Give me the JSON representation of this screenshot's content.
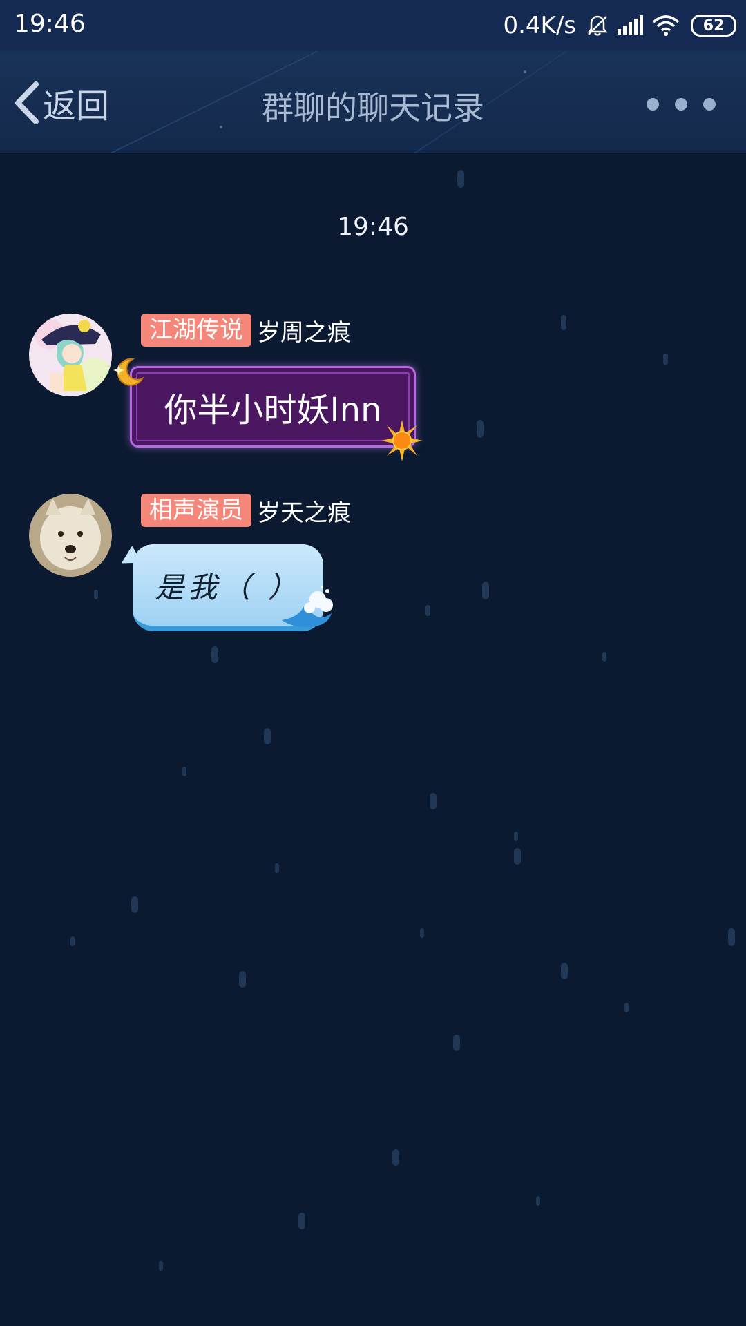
{
  "status_bar": {
    "time": "19:46",
    "net_speed": "0.4K/s",
    "battery": "62",
    "icons": [
      "bell-muted-icon",
      "signal-icon",
      "wifi-icon",
      "battery-icon"
    ]
  },
  "header": {
    "back_label": "返回",
    "title": "群聊的聊天记录",
    "more_icon": "more-icon"
  },
  "chat": {
    "timestamp": "19:46",
    "messages": [
      {
        "badge": "江湖传说",
        "sender": "岁周之痕",
        "text": "你半小时妖Inn",
        "bubble_style": "purple-moon-sun"
      },
      {
        "badge": "相声演员",
        "sender": "岁天之痕",
        "text": "是我（  ）",
        "bubble_style": "blue-wave"
      }
    ]
  },
  "colors": {
    "background": "#0b1a30",
    "header": "#173056",
    "badge": "#f4877a",
    "bubble1": "#4b1761",
    "bubble2": "#a9d8f6"
  }
}
